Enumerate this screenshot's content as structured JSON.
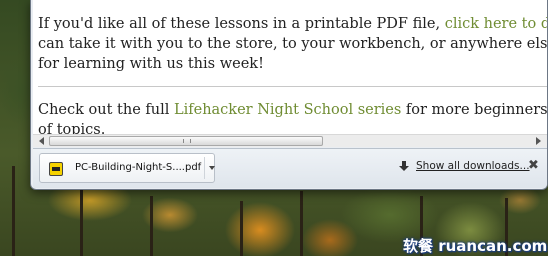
{
  "article": {
    "para1_pre": "If you'd like all of these lessons in a printable PDF file, ",
    "para1_link": "click here to download one",
    "para1_post": ". That way you can take it with you to the store, to your workbench, or anywhere else you may need it. Thanks for learning with us this week!",
    "para2_pre": "Check out the full ",
    "para2_link": "Lifehacker Night School series",
    "para2_post": " for more beginners lessons covering all kinds of topics.",
    "link_color": "#6f8c32"
  },
  "downloads": {
    "item_name": "PC-Building-Night-S....pdf",
    "item_icon": "pdf-icon",
    "show_all_label": "Show all downloads...",
    "close_glyph": "✖"
  },
  "watermark": {
    "text": "软餐 ruancan.com"
  }
}
